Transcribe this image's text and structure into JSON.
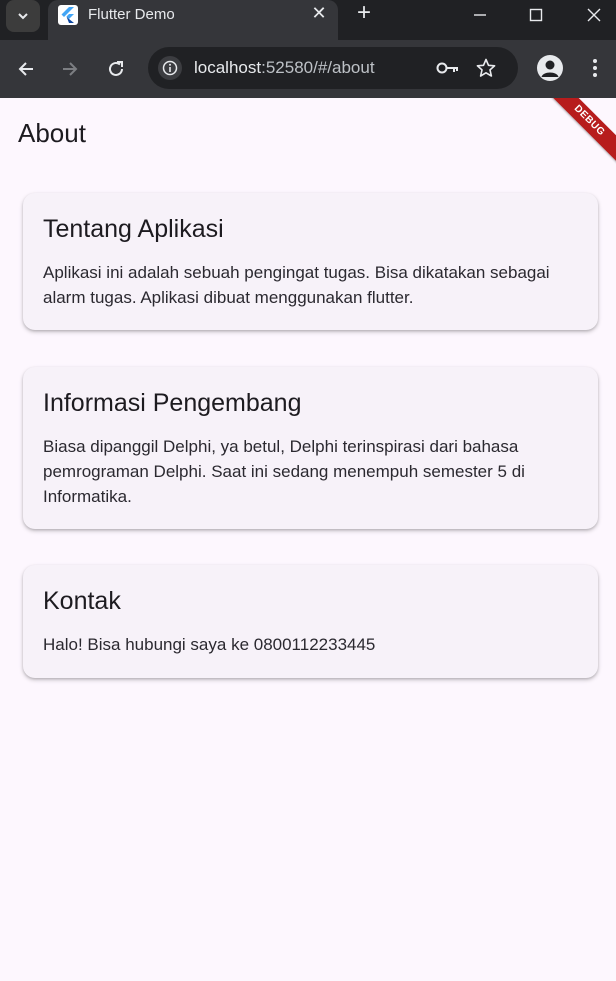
{
  "browser": {
    "tab_title": "Flutter Demo",
    "url_host": "localhost",
    "url_rest": ":52580/#/about"
  },
  "app": {
    "title": "About",
    "debug_banner": "DEBUG",
    "cards": [
      {
        "title": "Tentang Aplikasi",
        "body": "Aplikasi ini adalah sebuah pengingat tugas. Bisa dikatakan sebagai alarm tugas. Aplikasi dibuat menggunakan flutter."
      },
      {
        "title": "Informasi Pengembang",
        "body": "Biasa dipanggil Delphi, ya betul, Delphi terinspirasi dari bahasa pemrograman Delphi. Saat ini sedang menempuh semester 5 di Informatika."
      },
      {
        "title": "Kontak",
        "body": "Halo! Bisa hubungi saya ke 0800112233445"
      }
    ]
  },
  "colors": {
    "background": "#fdf7fe",
    "card": "#f7f2f9",
    "debug": "#b71c1c"
  }
}
